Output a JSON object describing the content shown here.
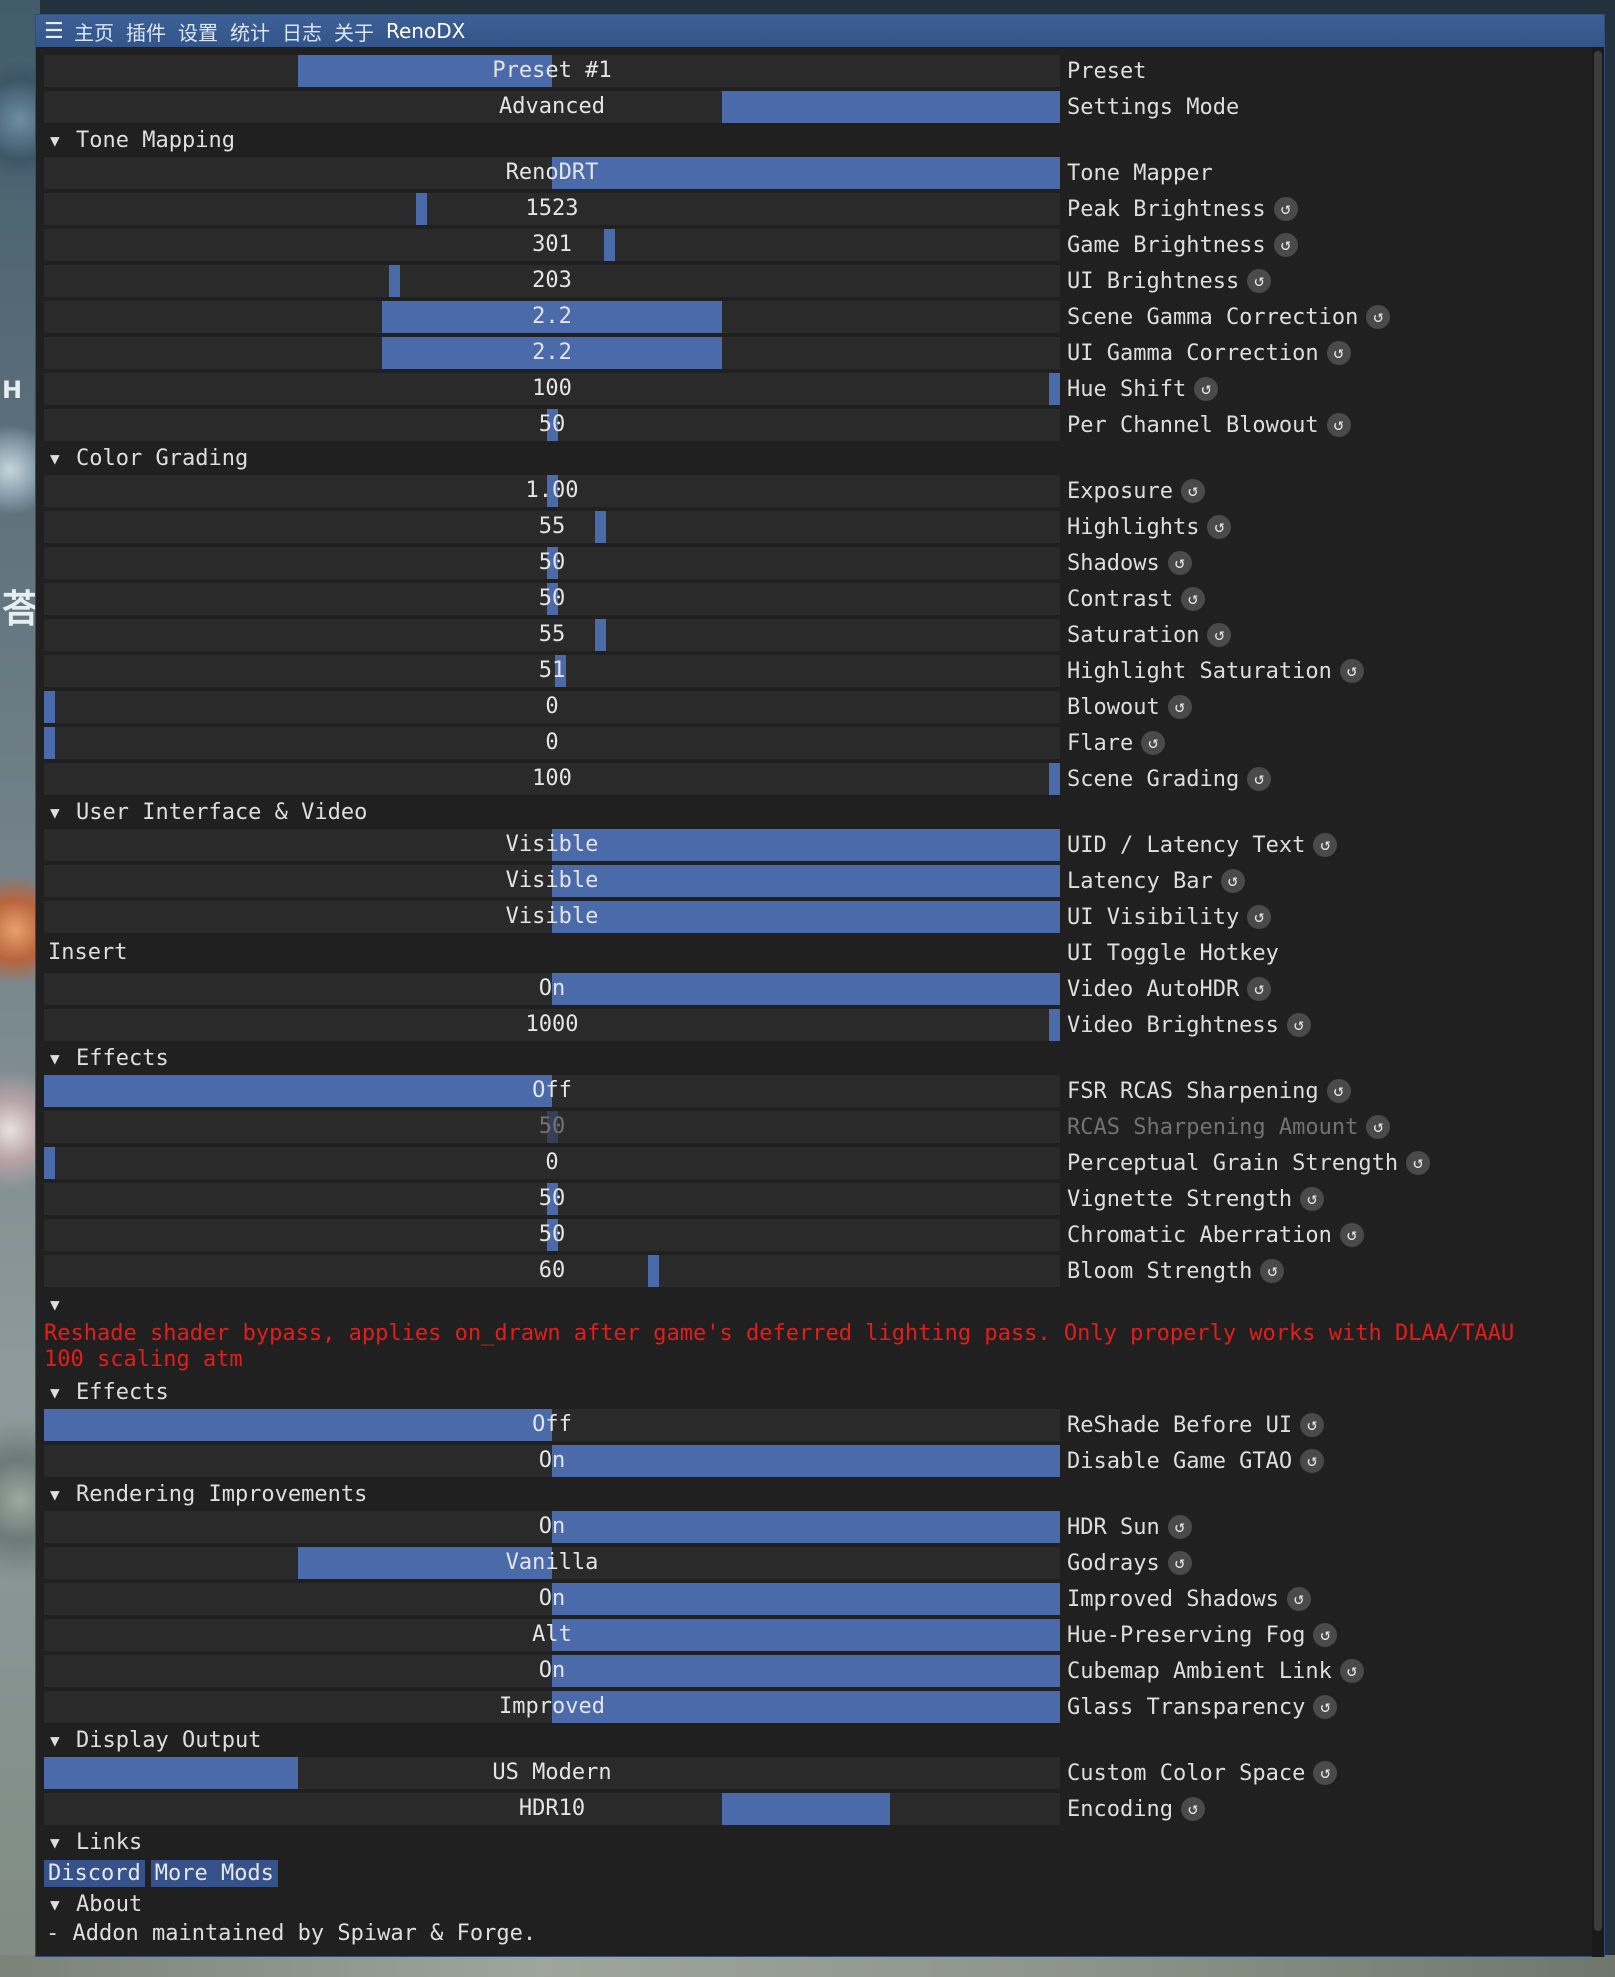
{
  "titlebar": {
    "menu": [
      "主页",
      "插件",
      "设置",
      "统计",
      "日志",
      "关于"
    ],
    "active": "RenoDX"
  },
  "side": {
    "letter_h": "H",
    "glyph": "荅"
  },
  "rows_top": [
    {
      "id": "preset",
      "label": "Preset",
      "value": "Preset #1",
      "fill_start": 0.25,
      "fill_end": 0.5,
      "reset": false
    },
    {
      "id": "settings-mode",
      "label": "Settings Mode",
      "value": "Advanced",
      "fill_start": 0.667,
      "fill_end": 1.0,
      "reset": false
    }
  ],
  "sections": {
    "tone_mapping": "Tone Mapping",
    "color_grading": "Color Grading",
    "ui_video": "User Interface & Video",
    "effects": "Effects",
    "effects2": "Effects",
    "rendering": "Rendering Improvements",
    "display": "Display Output",
    "links": "Links",
    "about": "About"
  },
  "tone_mapping": [
    {
      "label": "Tone Mapper",
      "value": "RenoDRT",
      "fill_start": 0.5,
      "fill_end": 1.0,
      "reset": false
    },
    {
      "label": "Peak Brightness",
      "value": "1523",
      "marker": 0.372,
      "reset": true
    },
    {
      "label": "Game Brightness",
      "value": "301",
      "marker": 0.557,
      "reset": true
    },
    {
      "label": "UI Brightness",
      "value": "203",
      "marker": 0.345,
      "reset": true
    },
    {
      "label": "Scene Gamma Correction",
      "value": "2.2",
      "fill_start": 0.333,
      "fill_end": 0.667,
      "reset": true
    },
    {
      "label": "UI Gamma Correction",
      "value": "2.2",
      "fill_start": 0.333,
      "fill_end": 0.667,
      "reset": true
    },
    {
      "label": "Hue Shift",
      "value": "100",
      "marker": 0.995,
      "reset": true
    },
    {
      "label": "Per Channel Blowout",
      "value": "50",
      "marker": 0.5,
      "reset": true
    }
  ],
  "color_grading": [
    {
      "label": "Exposure",
      "value": "1.00",
      "marker": 0.5,
      "reset": true
    },
    {
      "label": "Highlights",
      "value": "55",
      "marker": 0.548,
      "reset": true
    },
    {
      "label": "Shadows",
      "value": "50",
      "marker": 0.5,
      "reset": true
    },
    {
      "label": "Contrast",
      "value": "50",
      "marker": 0.5,
      "reset": true
    },
    {
      "label": "Saturation",
      "value": "55",
      "marker": 0.548,
      "reset": true
    },
    {
      "label": "Highlight Saturation",
      "value": "51",
      "marker": 0.508,
      "reset": true
    },
    {
      "label": "Blowout",
      "value": "0",
      "marker": 0.005,
      "reset": true
    },
    {
      "label": "Flare",
      "value": "0",
      "marker": 0.005,
      "reset": true
    },
    {
      "label": "Scene Grading",
      "value": "100",
      "marker": 0.995,
      "reset": true
    }
  ],
  "ui_video": [
    {
      "label": "UID / Latency Text",
      "value": "Visible",
      "fill_start": 0.5,
      "fill_end": 1.0,
      "reset": true
    },
    {
      "label": "Latency Bar",
      "value": "Visible",
      "fill_start": 0.5,
      "fill_end": 1.0,
      "reset": true
    },
    {
      "label": "UI Visibility",
      "value": "Visible",
      "fill_start": 0.5,
      "fill_end": 1.0,
      "reset": true
    }
  ],
  "hotkey": {
    "label": "UI Toggle Hotkey",
    "value": "Insert"
  },
  "ui_video2": [
    {
      "label": "Video AutoHDR",
      "value": "On",
      "fill_start": 0.5,
      "fill_end": 1.0,
      "reset": true
    },
    {
      "label": "Video Brightness",
      "value": "1000",
      "marker": 0.995,
      "reset": true
    }
  ],
  "effects": [
    {
      "label": "FSR RCAS Sharpening",
      "value": "Off",
      "fill_start": 0.0,
      "fill_end": 0.5,
      "reset": true
    },
    {
      "label": "RCAS Sharpening Amount",
      "value": "50",
      "marker": 0.5,
      "reset": true,
      "disabled": true
    },
    {
      "label": "Perceptual Grain Strength",
      "value": "0",
      "marker": 0.005,
      "reset": true
    },
    {
      "label": "Vignette Strength",
      "value": "50",
      "marker": 0.5,
      "reset": true
    },
    {
      "label": "Chromatic Aberration",
      "value": "50",
      "marker": 0.5,
      "reset": true
    },
    {
      "label": "Bloom Strength",
      "value": "60",
      "marker": 0.6,
      "reset": true
    }
  ],
  "warning": "Reshade shader bypass, applies on_drawn after game's deferred lighting pass. Only properly works with DLAA/TAAU 100 scaling atm",
  "effects2": [
    {
      "label": "ReShade Before UI",
      "value": "Off",
      "fill_start": 0.0,
      "fill_end": 0.5,
      "reset": true
    },
    {
      "label": "Disable Game GTAO",
      "value": "On",
      "fill_start": 0.5,
      "fill_end": 1.0,
      "reset": true
    }
  ],
  "rendering": [
    {
      "label": "HDR Sun",
      "value": "On",
      "fill_start": 0.5,
      "fill_end": 1.0,
      "reset": true
    },
    {
      "label": "Godrays",
      "value": "Vanilla",
      "fill_start": 0.25,
      "fill_end": 0.5,
      "reset": true
    },
    {
      "label": "Improved Shadows",
      "value": "On",
      "fill_start": 0.5,
      "fill_end": 1.0,
      "reset": true
    },
    {
      "label": "Hue-Preserving Fog",
      "value": "Alt",
      "fill_start": 0.5,
      "fill_end": 1.0,
      "reset": true
    },
    {
      "label": "Cubemap Ambient Link",
      "value": "On",
      "fill_start": 0.5,
      "fill_end": 1.0,
      "reset": true
    },
    {
      "label": "Glass Transparency",
      "value": "Improved",
      "fill_start": 0.5,
      "fill_end": 1.0,
      "reset": true
    }
  ],
  "display": [
    {
      "label": "Custom Color Space",
      "value": "US Modern",
      "fill_start": 0.0,
      "fill_end": 0.25,
      "reset": true
    },
    {
      "label": "Encoding",
      "value": "HDR10",
      "fill_start": 0.667,
      "fill_end": 0.833,
      "reset": true
    }
  ],
  "links": [
    "Discord",
    "More Mods"
  ],
  "about": "- Addon maintained by Spiwar & Forge.",
  "colors": {
    "accent": "#4a6aaa",
    "warning": "#e61c1c",
    "panel": "#202020",
    "frame": "#2a2a2a"
  }
}
